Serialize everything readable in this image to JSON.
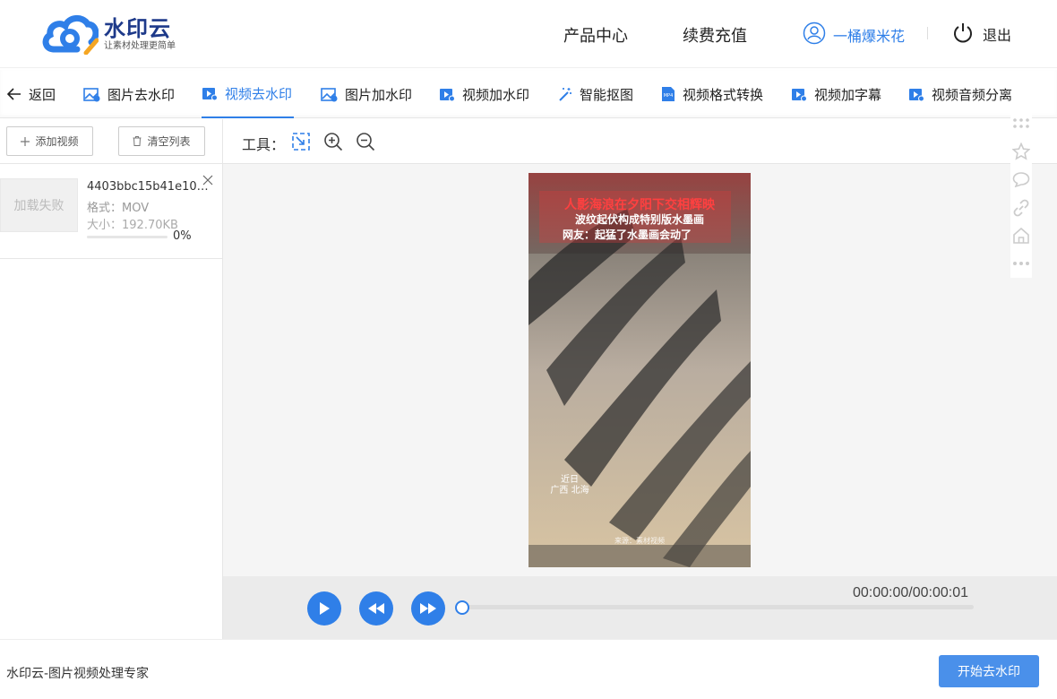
{
  "brand": {
    "title": "水印云",
    "subtitle": "让素材处理更简单",
    "logo_icon": "cloud-logo-icon",
    "accent": "#2f7fe8"
  },
  "header": {
    "nav": [
      {
        "label": "产品中心"
      },
      {
        "label": "续费充值"
      }
    ],
    "user": {
      "name": "一桶爆米花",
      "icon": "user-icon"
    },
    "logout": {
      "label": "退出",
      "icon": "power-icon"
    }
  },
  "tabs": {
    "back": "返回",
    "items": [
      {
        "label": "图片去水印",
        "icon": "image-icon"
      },
      {
        "label": "视频去水印",
        "icon": "video-icon",
        "active": true
      },
      {
        "label": "图片加水印",
        "icon": "image-icon"
      },
      {
        "label": "视频加水印",
        "icon": "video-icon"
      },
      {
        "label": "智能抠图",
        "icon": "magic-wand-icon"
      },
      {
        "label": "视频格式转换",
        "icon": "mp4-icon"
      },
      {
        "label": "视频加字幕",
        "icon": "video-icon"
      },
      {
        "label": "视频音频分离",
        "icon": "video-icon"
      }
    ]
  },
  "left_panel": {
    "add_button": "添加视频",
    "clear_button": "清空列表",
    "files": [
      {
        "thumb_text": "加载失败",
        "name": "4403bbc15b41e1097...",
        "format": "格式：MOV",
        "size": "大小：192.70KB",
        "progress": 0,
        "progress_label": "0%"
      }
    ]
  },
  "toolbar": {
    "label": "工具：",
    "tools": [
      "select-region-icon",
      "zoom-in-icon",
      "zoom-out-icon"
    ]
  },
  "video": {
    "caption_lines": [
      "人影海浪在夕阳下交相辉映",
      "波纹起伏构成特别版水墨画",
      "网友：起猛了水墨画会动了"
    ],
    "location_lines": [
      "近日",
      "广西 北海"
    ],
    "credit": "来源：素材视频"
  },
  "player": {
    "time": "00:00:00/00:00:01",
    "progress": 0,
    "buttons": [
      "play-icon",
      "rewind-icon",
      "fast-forward-icon"
    ]
  },
  "side_tools": [
    "grid-dots-icon",
    "star-icon",
    "comment-icon",
    "link-icon",
    "home-icon",
    "more-icon"
  ],
  "footer": {
    "text": "水印云-图片视频处理专家",
    "start_button": "开始去水印"
  }
}
